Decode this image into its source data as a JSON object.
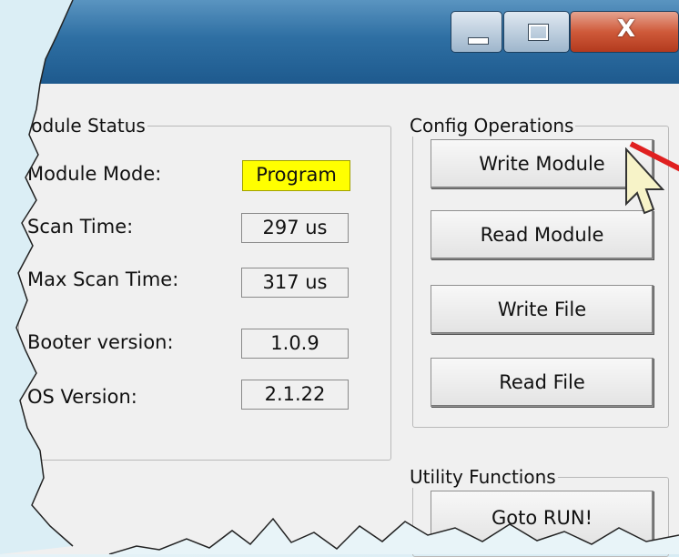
{
  "window": {
    "controls": {
      "minimize_icon": "minimize-icon",
      "maximize_icon": "maximize-icon",
      "close_label": "X"
    }
  },
  "module_status": {
    "group_title": "Module Status",
    "rows": [
      {
        "label": "Module Mode:",
        "value": "Program"
      },
      {
        "label": "Scan Time:",
        "value": "297 us"
      },
      {
        "label": "Max Scan Time:",
        "value": "317 us"
      },
      {
        "label": "Booter version:",
        "value": "1.0.9"
      },
      {
        "label": "OS Version:",
        "value": "2.1.22"
      }
    ]
  },
  "config_operations": {
    "group_title": "Config Operations",
    "buttons": [
      "Write Module",
      "Read Module",
      "Write File",
      "Read File"
    ]
  },
  "utility_functions": {
    "group_title": "Utility Functions",
    "buttons": [
      "Goto RUN!"
    ]
  },
  "colors": {
    "mode_highlight": "#ffff00",
    "title_bar": "#2e6fa3",
    "close_button": "#cf5a3a",
    "callout_arrow": "#e02020"
  }
}
